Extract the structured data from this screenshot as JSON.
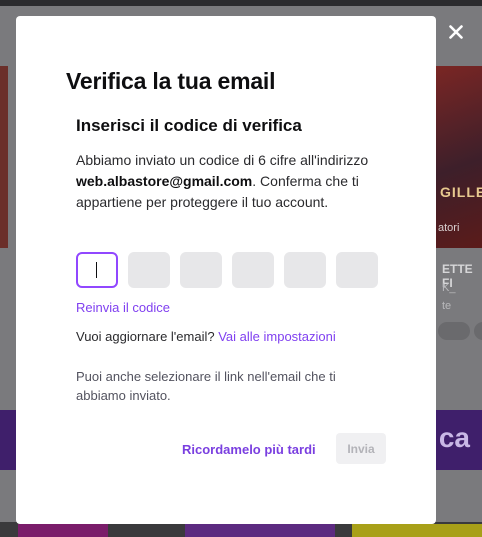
{
  "background": {
    "right_card_word": "GILLETT",
    "right_card_sub": "atori",
    "meta_title": "ETTE FI",
    "meta_line": "K_",
    "meta_line2": "te",
    "banner_text": "ca"
  },
  "modal": {
    "title": "Verifica la tua email",
    "section_title": "Inserisci il codice di verifica",
    "description_before": "Abbiamo inviato un codice di 6 cifre all'indirizzo ",
    "email": "web.albastore@gmail.com",
    "description_after": ". Conferma che ti appartiene per proteggere il tuo account.",
    "code_digits": [
      "",
      "",
      "",
      "",
      "",
      ""
    ],
    "resend_link": "Reinvia il codice",
    "update_prompt": "Vuoi aggiornare l'email?",
    "settings_link": "Vai alle impostazioni",
    "alt_note": "Puoi anche selezionare il link nell'email che ti abbiamo inviato.",
    "remind_later": "Ricordamelo più tardi",
    "submit": "Invia",
    "close_icon": "close-icon"
  },
  "colors": {
    "accent": "#9147ff",
    "link": "#8040f0",
    "disabled_text": "#b3b3b8",
    "overlay": "#7a7a7d"
  }
}
